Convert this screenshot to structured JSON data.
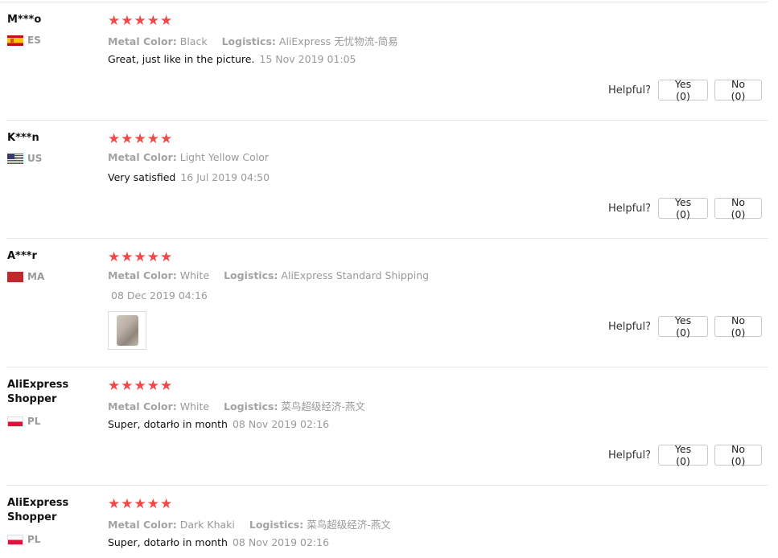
{
  "labels": {
    "metal_color": "Metal Color:",
    "logistics": "Logistics:",
    "helpful": "Helpful?",
    "yes": "Yes (0)",
    "no": "No (0)"
  },
  "reviews": [
    {
      "user": "M***o",
      "country": "ES",
      "flag": "spain-flag-icon",
      "stars": "★★★★★",
      "rating": 5,
      "metal_color": "Black",
      "logistics": "AliExpress 无忧物流-简易",
      "text": "Great, just like in the picture.",
      "date": "15 Nov 2019 01:05"
    },
    {
      "user": "K***n",
      "country": "US",
      "flag": "usa-flag-icon",
      "stars": "★★★★★",
      "rating": 5,
      "metal_color": "Light Yellow Color",
      "text": "Very satisfied",
      "date": "16 Jul 2019 04:50"
    },
    {
      "user": "A***r",
      "country": "MA",
      "flag": "morocco-flag-icon",
      "stars": "★★★★★",
      "rating": 5,
      "metal_color": "White",
      "logistics": "AliExpress Standard Shipping",
      "date": "08 Dec 2019 04:16"
    },
    {
      "user": "AliExpress Shopper",
      "country": "PL",
      "flag": "poland-flag-icon",
      "stars": "★★★★★",
      "rating": 5,
      "metal_color": "White",
      "logistics": "菜鸟超级经济-燕文",
      "text": "Super, dotarło in month",
      "date": "08 Nov 2019 02:16"
    },
    {
      "user": "AliExpress Shopper",
      "country": "PL",
      "flag": "poland-flag-icon",
      "stars": "★★★★★",
      "rating": 5,
      "metal_color": "Dark Khaki",
      "logistics": "菜鸟超级经济-燕文",
      "text": "Super, dotarło in month",
      "date": "08 Nov 2019 02:16"
    }
  ]
}
